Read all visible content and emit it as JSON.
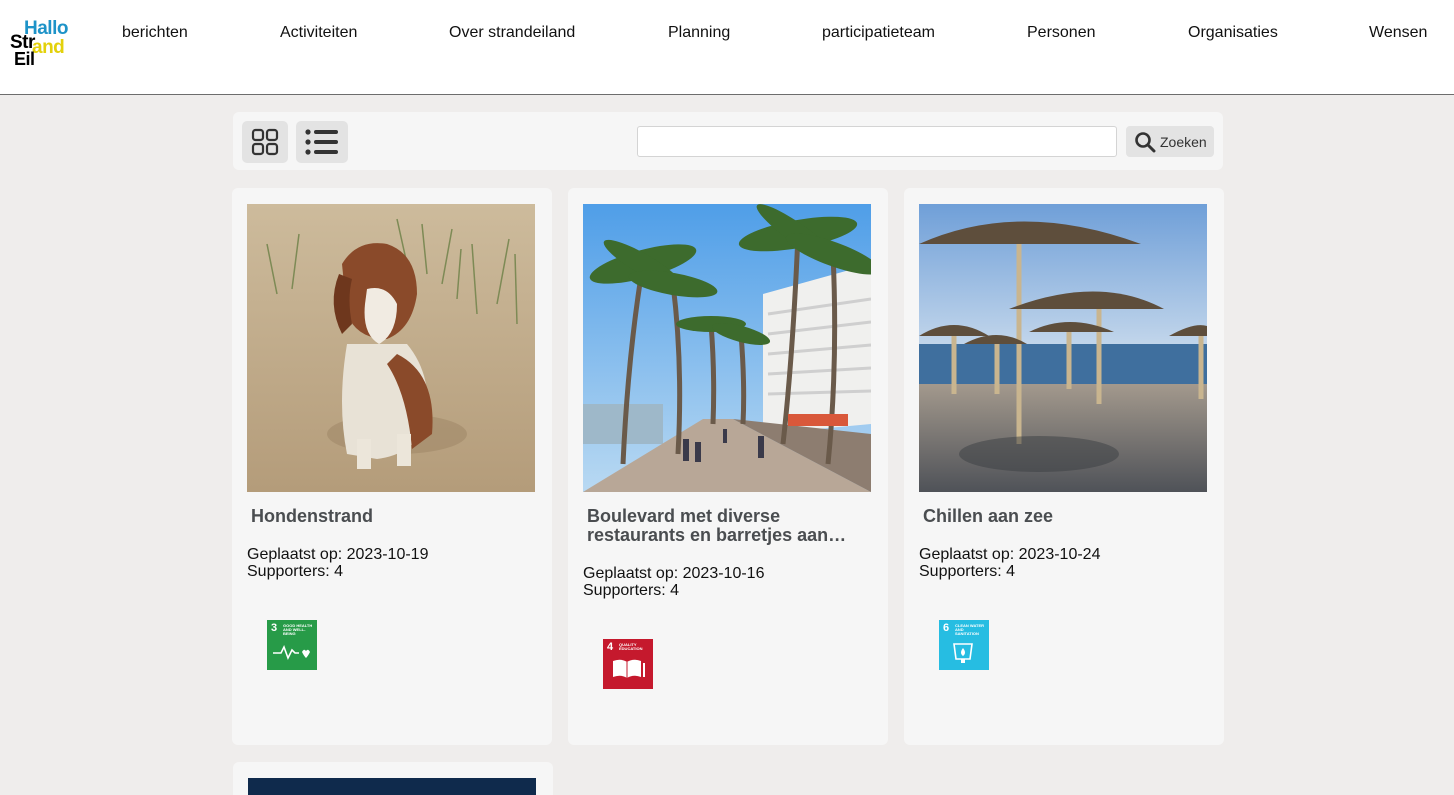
{
  "logo": {
    "line1": "Hallo",
    "line2": "Str",
    "line2b": "and",
    "line3": "Eil"
  },
  "nav": [
    {
      "label": "berichten"
    },
    {
      "label": "Activiteiten"
    },
    {
      "label": "Over strandeiland"
    },
    {
      "label": "Planning"
    },
    {
      "label": "participatieteam"
    },
    {
      "label": "Personen"
    },
    {
      "label": "Organisaties"
    },
    {
      "label": "Wensen"
    }
  ],
  "toolbar": {
    "grid_view_icon": "grid-icon",
    "list_view_icon": "list-icon",
    "search_value": "",
    "search_label": "Zoeken"
  },
  "cards": [
    {
      "title": "Hondenstrand",
      "posted_label": "Geplaatst op: 2023-10-19",
      "supporters_label": "Supporters: 4",
      "photo": "dog-on-beach",
      "sdg": {
        "number": "3",
        "caption": "GOOD HEALTH AND WELL-BEING",
        "color": "#279b48"
      }
    },
    {
      "title": "Boulevard met diverse restaurants en barretjes aan…",
      "posted_label": "Geplaatst op: 2023-10-16",
      "supporters_label": "Supporters: 4",
      "photo": "palm-boulevard",
      "sdg": {
        "number": "4",
        "caption": "QUALITY EDUCATION",
        "color": "#c5192d"
      }
    },
    {
      "title": "Chillen aan zee",
      "posted_label": "Geplaatst op: 2023-10-24",
      "supporters_label": "Supporters: 4",
      "photo": "beach-umbrellas",
      "sdg": {
        "number": "6",
        "caption": "CLEAN WATER AND SANITATION",
        "color": "#26bde2"
      }
    }
  ],
  "colors": {
    "header_bg": "#ffffff",
    "page_bg": "#efedec",
    "card_bg": "#f6f6f6",
    "title_text": "#4a4d50"
  }
}
